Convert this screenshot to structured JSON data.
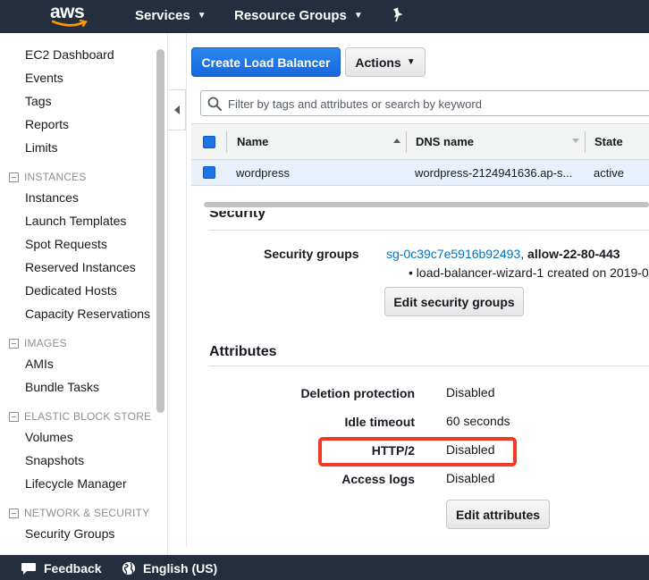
{
  "topnav": {
    "logo_text": "aws",
    "services_label": "Services",
    "resource_groups_label": "Resource Groups",
    "pin_icon": "pin-icon",
    "colors": {
      "bg": "#232f3e",
      "smile": "#ff9900"
    }
  },
  "sidebar": {
    "top_links": [
      "EC2 Dashboard",
      "Events",
      "Tags",
      "Reports",
      "Limits"
    ],
    "sections": [
      {
        "title": "INSTANCES",
        "items": [
          "Instances",
          "Launch Templates",
          "Spot Requests",
          "Reserved Instances",
          "Dedicated Hosts",
          "Capacity Reservations"
        ]
      },
      {
        "title": "IMAGES",
        "items": [
          "AMIs",
          "Bundle Tasks"
        ]
      },
      {
        "title": "ELASTIC BLOCK STORE",
        "items": [
          "Volumes",
          "Snapshots",
          "Lifecycle Manager"
        ]
      },
      {
        "title": "NETWORK & SECURITY",
        "items": [
          "Security Groups"
        ]
      }
    ]
  },
  "toolbar": {
    "create_label": "Create Load Balancer",
    "actions_label": "Actions"
  },
  "filter": {
    "placeholder": "Filter by tags and attributes or search by keyword"
  },
  "table": {
    "columns": [
      "Name",
      "DNS name",
      "State"
    ],
    "rows": [
      {
        "name": "wordpress",
        "dns": "wordpress-2124941636.ap-s...",
        "state": "active"
      }
    ]
  },
  "security": {
    "heading": "Security",
    "groups_label": "Security groups",
    "group_id": "sg-0c39c7e5916b92493",
    "group_sep": ",",
    "group_name": "allow-22-80-443",
    "group_desc": "• load-balancer-wizard-1 created on 2019-0",
    "edit_label": "Edit security groups"
  },
  "attributes": {
    "heading": "Attributes",
    "rows": [
      {
        "label": "Deletion protection",
        "value": "Disabled"
      },
      {
        "label": "Idle timeout",
        "value": "60 seconds"
      },
      {
        "label": "HTTP/2",
        "value": "Disabled"
      },
      {
        "label": "Access logs",
        "value": "Disabled"
      }
    ],
    "edit_label": "Edit attributes",
    "highlight_color": "#f03a25"
  },
  "footer": {
    "feedback_label": "Feedback",
    "language_label": "English (US)"
  }
}
